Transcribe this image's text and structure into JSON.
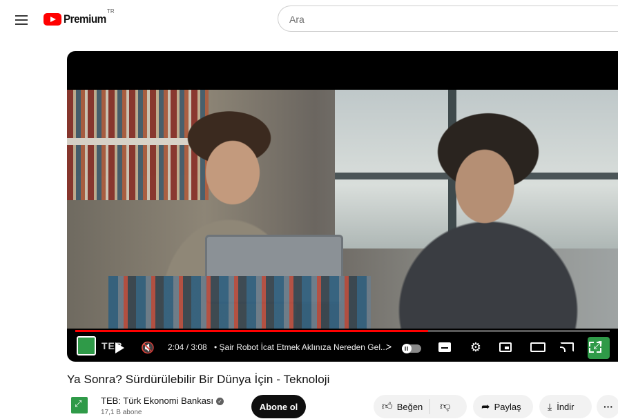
{
  "header": {
    "logo_text": "Premium",
    "logo_region": "TR",
    "search_placeholder": "Ara"
  },
  "player": {
    "brand_text": "TEB",
    "current_time": "2:04",
    "duration": "3:08",
    "time_display": "2:04 / 3:08",
    "chapter": "• Şair Robot İcat Etmek Aklınıza Nereden Gel...",
    "chapter_chevron": ">",
    "progress_percent": 66,
    "icons": [
      "play-icon",
      "next-icon",
      "mute-icon",
      "autoplay-toggle",
      "subtitles-icon",
      "settings-icon",
      "miniplayer-icon",
      "theater-icon",
      "cast-icon",
      "fullscreen-icon"
    ]
  },
  "video": {
    "title": "Ya Sonra? Sürdürülebilir Bir Dünya İçin - Teknoloji"
  },
  "channel": {
    "name": "TEB: Türk Ekonomi Bankası",
    "subscribers": "17,1 B abone",
    "subscribe_label": "Abone ol"
  },
  "actions": {
    "like_label": "Beğen",
    "share_label": "Paylaş",
    "download_label": "İndir",
    "more_label": "···"
  },
  "colors": {
    "brand_red": "#ff0000",
    "progress_red": "#ff0000",
    "channel_green": "#2f9a48",
    "subscribe_bg": "#0f0f0f"
  }
}
